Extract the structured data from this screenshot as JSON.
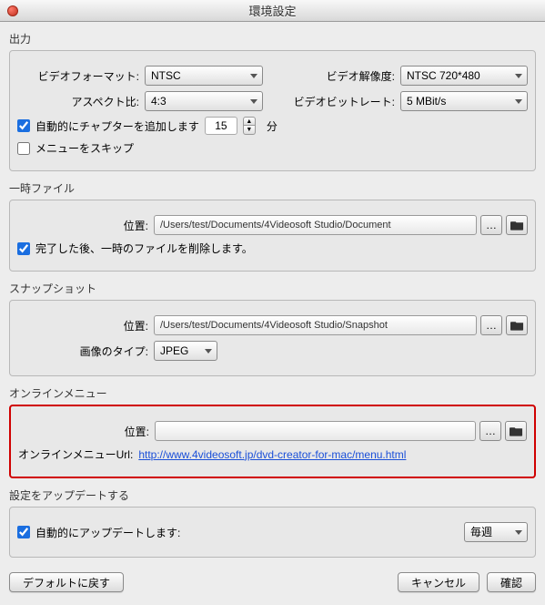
{
  "window": {
    "title": "環境設定"
  },
  "output": {
    "legend": "出力",
    "video_format_label": "ビデオフォーマット:",
    "video_format_value": "NTSC",
    "video_res_label": "ビデオ解像度:",
    "video_res_value": "NTSC 720*480",
    "aspect_label": "アスペクト比:",
    "aspect_value": "4:3",
    "bitrate_label": "ビデオビットレート:",
    "bitrate_value": "5 MBit/s",
    "auto_chapter_label": "自動的にチャプターを追加します",
    "auto_chapter_value": "15",
    "auto_chapter_unit": "分",
    "skip_menu_label": "メニューをスキップ"
  },
  "temp": {
    "legend": "一時ファイル",
    "loc_label": "位置:",
    "path": "/Users/test/Documents/4Videosoft Studio/Document",
    "delete_after_label": "完了した後、一時のファイルを削除します。"
  },
  "snapshot": {
    "legend": "スナップショット",
    "loc_label": "位置:",
    "path": "/Users/test/Documents/4Videosoft Studio/Snapshot",
    "img_type_label": "画像のタイプ:",
    "img_type_value": "JPEG"
  },
  "online": {
    "legend": "オンラインメニュー",
    "loc_label": "位置:",
    "path": "",
    "url_label": "オンラインメニューUrl:",
    "url": "http://www.4videosoft.jp/dvd-creator-for-mac/menu.html"
  },
  "update": {
    "legend": "設定をアップデートする",
    "auto_label": "自動的にアップデートします:",
    "freq_value": "毎週"
  },
  "footer": {
    "default": "デフォルトに戻す",
    "cancel": "キャンセル",
    "ok": "確認"
  }
}
